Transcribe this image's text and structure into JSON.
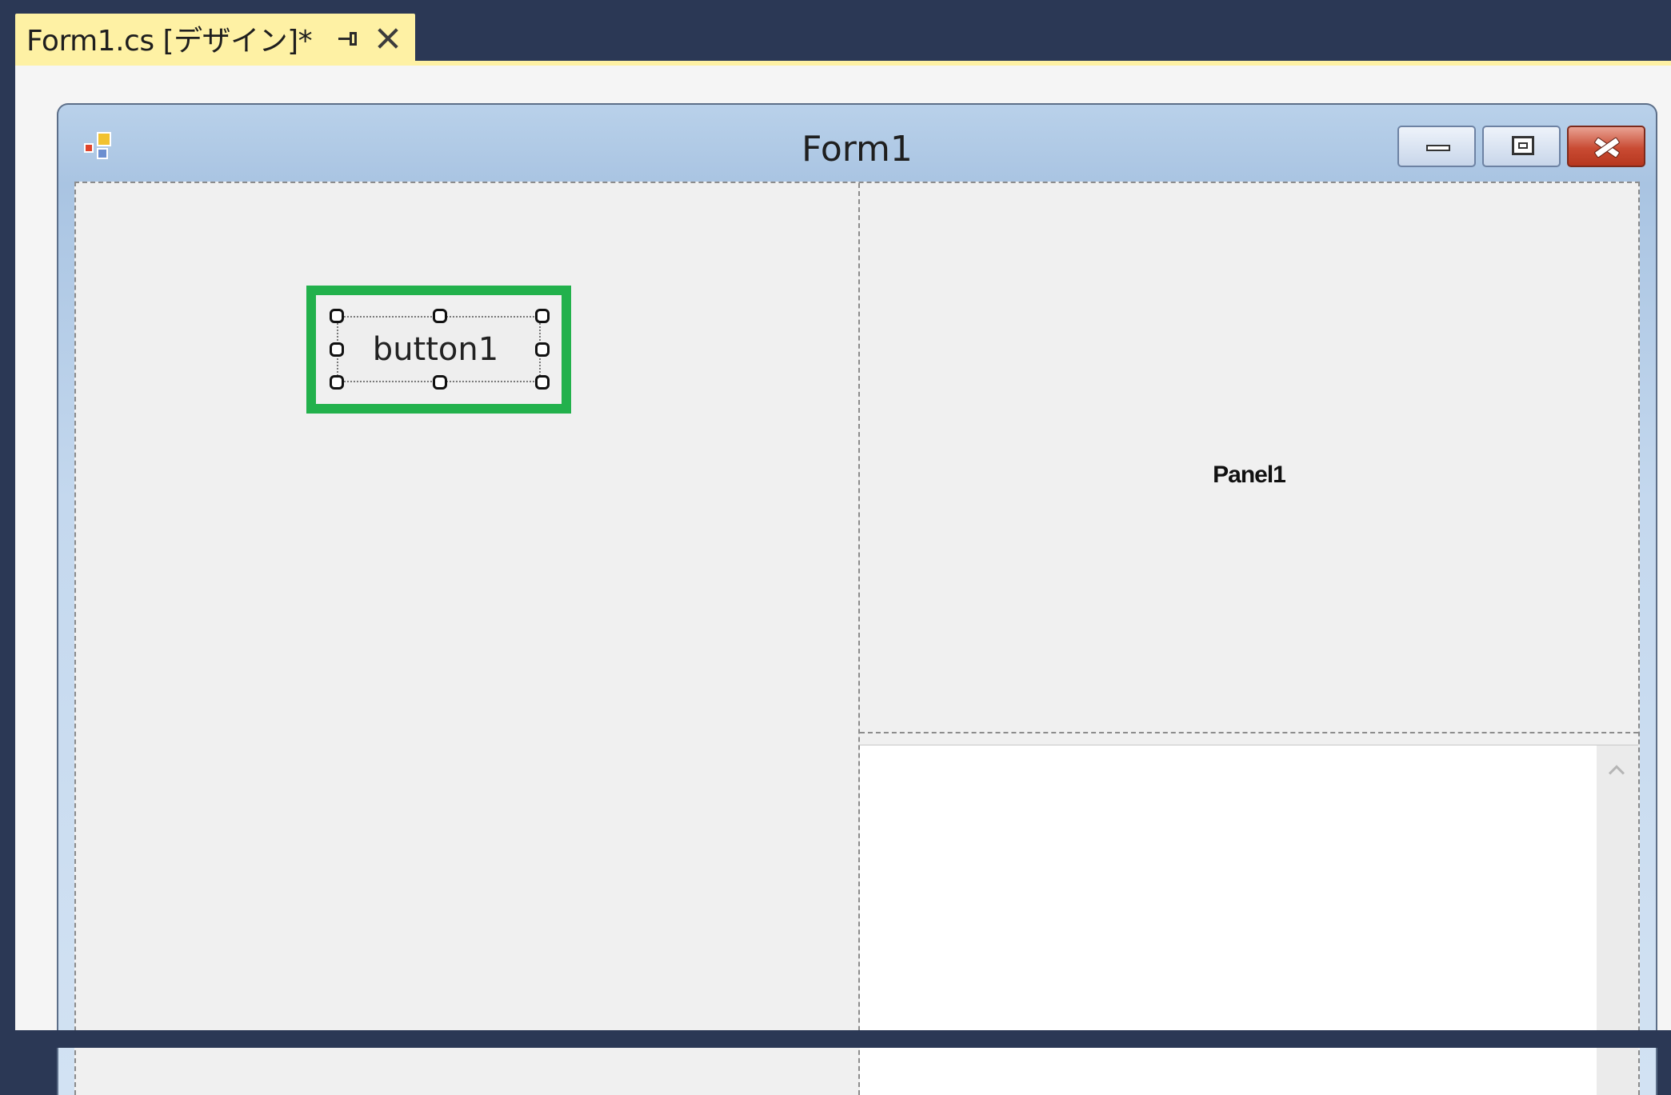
{
  "document_tab": {
    "title": "Form1.cs [デザイン]*",
    "pin_icon": "pin-icon",
    "close_icon": "close-icon"
  },
  "form": {
    "title": "Form1",
    "app_icon": "form-app-icon",
    "caption_buttons": [
      "minimize",
      "maximize",
      "close"
    ]
  },
  "controls": {
    "button1_label": "button1",
    "panel1_label": "Panel1"
  },
  "colors": {
    "ide_background": "#2b3855",
    "tab_active": "#fef1a4",
    "selection_highlight": "#22b14c",
    "close_button": "#c94b33"
  }
}
